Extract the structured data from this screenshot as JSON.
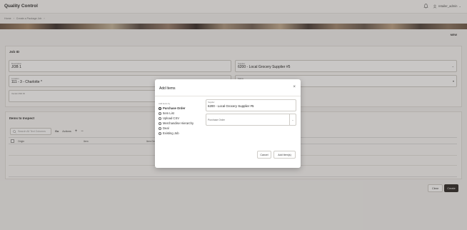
{
  "header": {
    "app_title": "Quality Control",
    "user": "retailer_admin"
  },
  "breadcrumb": [
    "Home",
    "Create a Package Job"
  ],
  "new_label": "NEW",
  "job_panel": {
    "title": "Job ID",
    "description": {
      "label": "Description",
      "value": "JOB 1"
    },
    "supplier": {
      "label": "Supplier",
      "value": "6200 - Local Grocery Supplier #5"
    },
    "location": {
      "label": "Location",
      "value": "111 - 3 - Charlotte *"
    },
    "status": {
      "label": "Status",
      "value": ""
    },
    "vendor_ref": {
      "label": "Vendor ASN ID",
      "value": ""
    }
  },
  "items_panel": {
    "title": "Items to Inspect",
    "search_placeholder": "Search All Text Columns",
    "go_label": "Go",
    "actions_label": "Actions",
    "add": "+",
    "remove": "−",
    "columns": [
      "Origin",
      "Item",
      "Item Description"
    ]
  },
  "buttons": {
    "clear": "Clear",
    "create": "Create"
  },
  "dialog": {
    "title": "Add Items",
    "add_items_by_label": "Add items by",
    "options": [
      "Purchase Order",
      "Item List",
      "Upload CSV",
      "Merchandise Hierarchy",
      "Deal",
      "Existing Job"
    ],
    "selected": "Purchase Order",
    "supplier": {
      "label": "Supplier",
      "value": "6200 - Local Grocery Supplier #5"
    },
    "purchase_order_placeholder": "Purchase Order",
    "cancel": "Cancel",
    "add_items": "Add Item(s)"
  }
}
